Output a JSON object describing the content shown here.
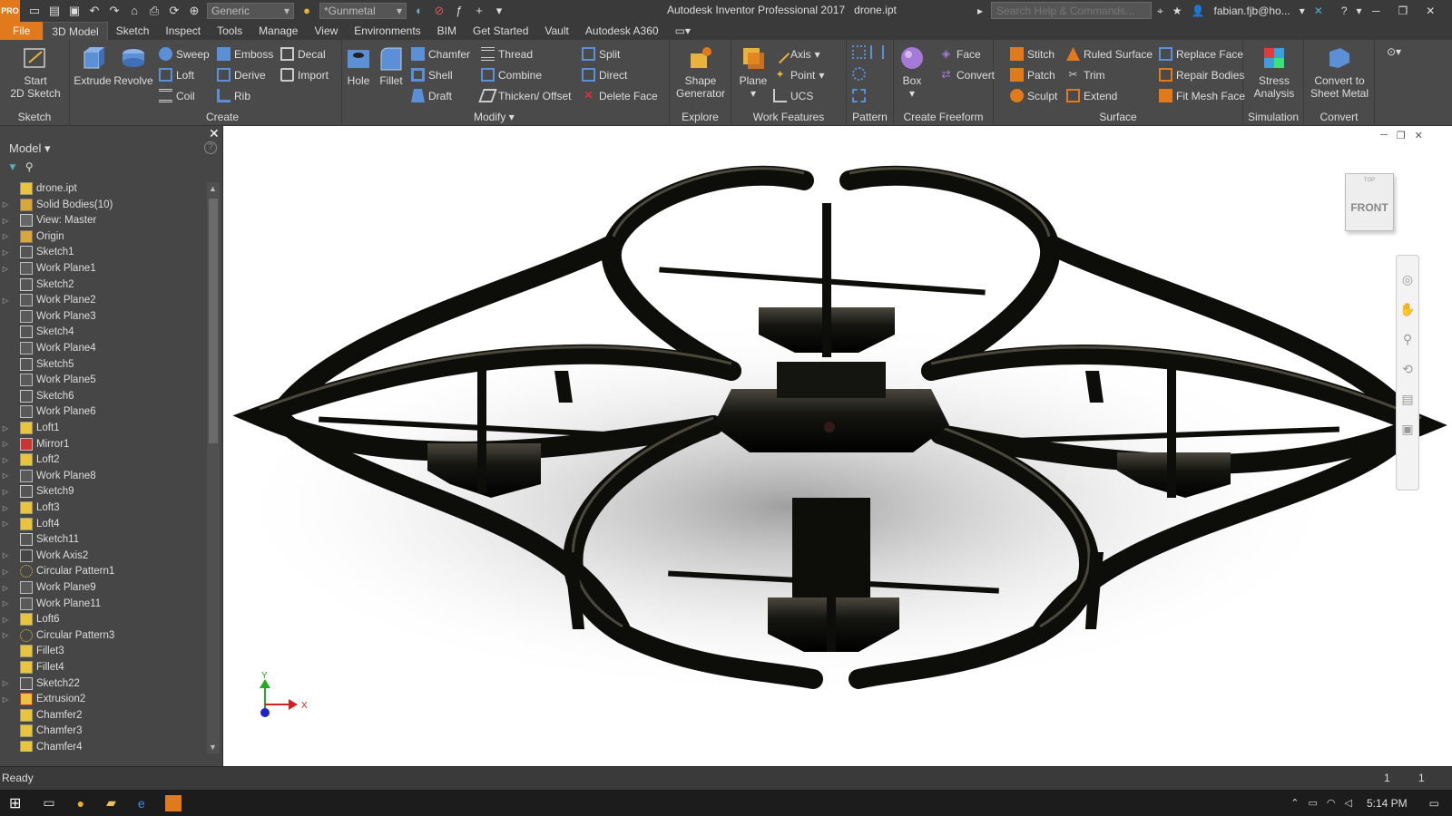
{
  "app": {
    "pro_badge": "PRO",
    "title": "Autodesk Inventor Professional 2017",
    "document": "drone.ipt",
    "material": "Generic",
    "appearance": "*Gunmetal",
    "search_placeholder": "Search Help & Commands...",
    "user": "fabian.fjb@ho..."
  },
  "tabs": [
    "File",
    "3D Model",
    "Sketch",
    "Inspect",
    "Tools",
    "Manage",
    "View",
    "Environments",
    "BIM",
    "Get Started",
    "Vault",
    "Autodesk A360"
  ],
  "ribbon": {
    "sketch": {
      "label": "Sketch",
      "start": "Start",
      "start2": "2D Sketch"
    },
    "create": {
      "label": "Create",
      "extrude": "Extrude",
      "revolve": "Revolve",
      "sweep": "Sweep",
      "loft": "Loft",
      "coil": "Coil",
      "emboss": "Emboss",
      "derive": "Derive",
      "rib": "Rib",
      "decal": "Decal",
      "import": "Import"
    },
    "modify": {
      "label": "Modify",
      "hole": "Hole",
      "fillet": "Fillet",
      "chamfer": "Chamfer",
      "shell": "Shell",
      "draft": "Draft",
      "thread": "Thread",
      "combine": "Combine",
      "thicken": "Thicken/ Offset",
      "split": "Split",
      "direct": "Direct",
      "delete_face": "Delete Face"
    },
    "explore": {
      "label": "Explore",
      "shape": "Shape",
      "generator": "Generator"
    },
    "work": {
      "label": "Work Features",
      "plane": "Plane",
      "axis": "Axis",
      "point": "Point",
      "ucs": "UCS"
    },
    "pattern": {
      "label": "Pattern"
    },
    "freeform": {
      "label": "Create Freeform",
      "box": "Box",
      "face": "Face",
      "convert": "Convert"
    },
    "surface": {
      "label": "Surface",
      "stitch": "Stitch",
      "patch": "Patch",
      "sculpt": "Sculpt",
      "ruled": "Ruled Surface",
      "trim": "Trim",
      "extend": "Extend",
      "replace": "Replace Face",
      "repair": "Repair Bodies",
      "fitmesh": "Fit Mesh Face"
    },
    "simulation": {
      "label": "Simulation",
      "stress": "Stress",
      "analysis": "Analysis"
    },
    "convert": {
      "label": "Convert",
      "c1": "Convert to",
      "c2": "Sheet Metal"
    }
  },
  "browser": {
    "title": "Model",
    "items": [
      {
        "label": "drone.ipt",
        "icon": "part-icon",
        "expand": false
      },
      {
        "label": "Solid Bodies(10)",
        "icon": "folder-icon",
        "expand": true
      },
      {
        "label": "View: Master",
        "icon": "view-icon",
        "expand": true
      },
      {
        "label": "Origin",
        "icon": "folder-icon",
        "expand": true
      },
      {
        "label": "Sketch1",
        "icon": "sketch-icon",
        "expand": true
      },
      {
        "label": "Work Plane1",
        "icon": "plane-icon",
        "expand": true
      },
      {
        "label": "Sketch2",
        "icon": "sketch-icon",
        "expand": false
      },
      {
        "label": "Work Plane2",
        "icon": "plane-icon",
        "expand": true
      },
      {
        "label": "Work Plane3",
        "icon": "plane-icon",
        "expand": false
      },
      {
        "label": "Sketch4",
        "icon": "sketch-icon",
        "expand": false
      },
      {
        "label": "Work Plane4",
        "icon": "plane-icon",
        "expand": false
      },
      {
        "label": "Sketch5",
        "icon": "sketch-icon",
        "expand": false
      },
      {
        "label": "Work Plane5",
        "icon": "plane-icon",
        "expand": false
      },
      {
        "label": "Sketch6",
        "icon": "sketch-icon",
        "expand": false
      },
      {
        "label": "Work Plane6",
        "icon": "plane-icon",
        "expand": false
      },
      {
        "label": "Loft1",
        "icon": "feature-icon",
        "expand": true
      },
      {
        "label": "Mirror1",
        "icon": "mirror-icon",
        "expand": true
      },
      {
        "label": "Loft2",
        "icon": "feature-icon",
        "expand": true
      },
      {
        "label": "Work Plane8",
        "icon": "plane-icon",
        "expand": true
      },
      {
        "label": "Sketch9",
        "icon": "sketch-icon",
        "expand": true
      },
      {
        "label": "Loft3",
        "icon": "feature-icon",
        "expand": true
      },
      {
        "label": "Loft4",
        "icon": "feature-icon",
        "expand": true
      },
      {
        "label": "Sketch11",
        "icon": "sketch-icon",
        "expand": false
      },
      {
        "label": "Work Axis2",
        "icon": "axis-icon",
        "expand": true
      },
      {
        "label": "Circular Pattern1",
        "icon": "pattern-icon",
        "expand": true
      },
      {
        "label": "Work Plane9",
        "icon": "plane-icon",
        "expand": true
      },
      {
        "label": "Work Plane11",
        "icon": "plane-icon",
        "expand": true
      },
      {
        "label": "Loft6",
        "icon": "feature-icon",
        "expand": true
      },
      {
        "label": "Circular Pattern3",
        "icon": "pattern-icon",
        "expand": true
      },
      {
        "label": "Fillet3",
        "icon": "feature-icon",
        "expand": false
      },
      {
        "label": "Fillet4",
        "icon": "feature-icon",
        "expand": false
      },
      {
        "label": "Sketch22",
        "icon": "sketch-icon",
        "expand": true
      },
      {
        "label": "Extrusion2",
        "icon": "extrude-icon",
        "expand": true
      },
      {
        "label": "Chamfer2",
        "icon": "feature-icon",
        "expand": false
      },
      {
        "label": "Chamfer3",
        "icon": "feature-icon",
        "expand": false
      },
      {
        "label": "Chamfer4",
        "icon": "feature-icon",
        "expand": false
      }
    ]
  },
  "viewcube": {
    "top": "TOP",
    "front": "FRONT"
  },
  "triad": {
    "x": "X",
    "y": "Y"
  },
  "status": {
    "text": "Ready",
    "count1": "1",
    "count2": "1"
  },
  "taskbar": {
    "time": "5:14 PM"
  },
  "colors": {
    "accent": "#e07a1c",
    "ribbon": "#4a4a4a",
    "titlebar": "#3a3a3a"
  }
}
